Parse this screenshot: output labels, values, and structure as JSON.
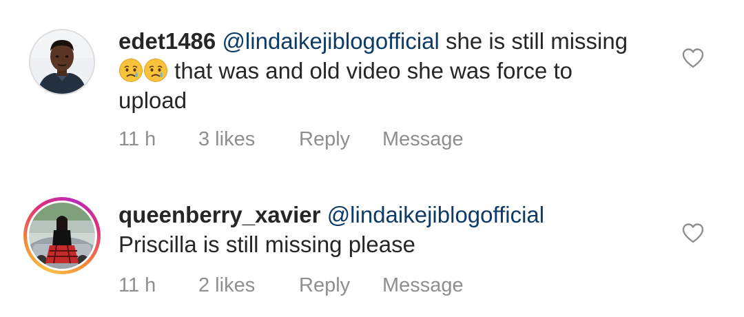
{
  "comments": [
    {
      "username": "edet1486",
      "mention": "@lindaikejiblogofficial",
      "text_part1": "she is still missing",
      "emojis": [
        "crying-face-icon",
        "crying-face-icon"
      ],
      "text_part2": "that was and old video she was force to upload",
      "time": "11 h",
      "likes": "3 likes",
      "reply_label": "Reply",
      "message_label": "Message",
      "has_story_ring": false
    },
    {
      "username": "queenberry_xavier",
      "mention": "@lindaikejiblogofficial",
      "text_part1": "Priscilla is still missing please",
      "time": "11 h",
      "likes": "2 likes",
      "reply_label": "Reply",
      "message_label": "Message",
      "has_story_ring": true
    }
  ],
  "colors": {
    "text": "#262626",
    "mention": "#0d3b66",
    "meta": "#8e8e8e"
  }
}
